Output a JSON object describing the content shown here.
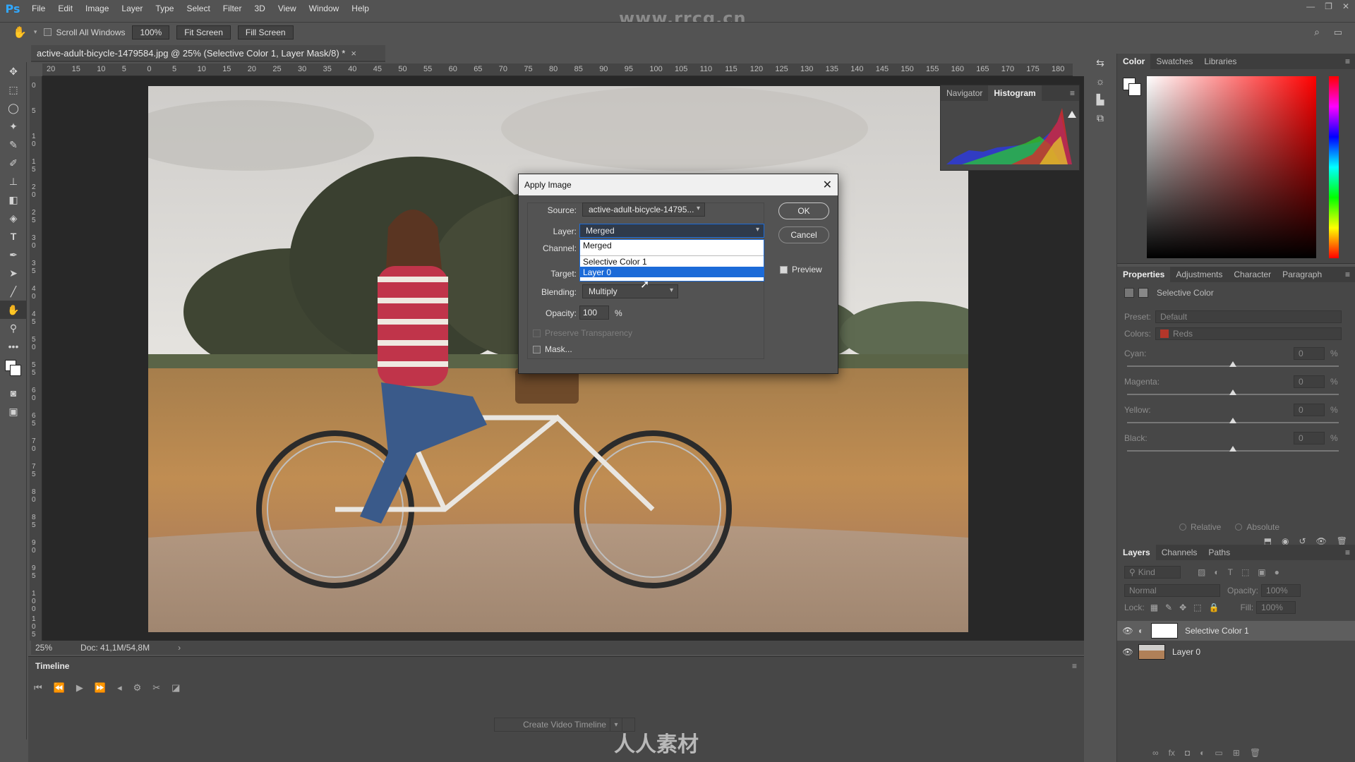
{
  "app": {
    "logo": "Ps",
    "watermark_site": "www.rrcg.cn",
    "watermark_bottom": "人人素材"
  },
  "menu": [
    "File",
    "Edit",
    "Image",
    "Layer",
    "Type",
    "Select",
    "Filter",
    "3D",
    "View",
    "Window",
    "Help"
  ],
  "options": {
    "scroll_all": "Scroll All Windows",
    "zoom": "100%",
    "fit_screen": "Fit Screen",
    "fill_screen": "Fill Screen"
  },
  "document": {
    "tab_title": "active-adult-bicycle-1479584.jpg @ 25% (Selective Color 1, Layer Mask/8) *",
    "close": "×"
  },
  "ruler_top": [
    "20",
    "15",
    "10",
    "5",
    "0",
    "5",
    "10",
    "15",
    "20",
    "25",
    "30",
    "35",
    "40",
    "45",
    "50",
    "55",
    "60",
    "65",
    "70",
    "75",
    "80",
    "85",
    "90",
    "95",
    "100",
    "105",
    "110",
    "115",
    "120",
    "125",
    "130",
    "135",
    "140",
    "145",
    "150",
    "155",
    "160",
    "165",
    "170",
    "175",
    "180"
  ],
  "ruler_left": [
    "0",
    "5",
    "1 0",
    "1 5",
    "2 0",
    "2 5",
    "3 0",
    "3 5",
    "4 0",
    "4 5",
    "5 0",
    "5 5",
    "6 0",
    "6 5",
    "7 0",
    "7 5",
    "8 0",
    "8 5",
    "9 0",
    "9 5",
    "1 0 0",
    "1 0 5"
  ],
  "status": {
    "zoom": "25%",
    "doc": "Doc: 41,1M/54,8M"
  },
  "timeline": {
    "title": "Timeline",
    "create_button": "Create Video Timeline"
  },
  "histogram_panel": {
    "tabs": [
      "Navigator",
      "Histogram"
    ],
    "active": "Histogram"
  },
  "color_panel": {
    "tabs": [
      "Color",
      "Swatches",
      "Libraries"
    ]
  },
  "properties_panel": {
    "tabs": [
      "Properties",
      "Adjustments",
      "Character",
      "Paragraph"
    ],
    "title": "Selective Color",
    "preset_label": "Preset:",
    "preset_value": "Default",
    "colors_label": "Colors:",
    "colors_value": "Reds",
    "sliders": [
      {
        "label": "Cyan:",
        "value": "0",
        "unit": "%"
      },
      {
        "label": "Magenta:",
        "value": "0",
        "unit": "%"
      },
      {
        "label": "Yellow:",
        "value": "0",
        "unit": "%"
      },
      {
        "label": "Black:",
        "value": "0",
        "unit": "%"
      }
    ],
    "relative": "Relative",
    "absolute": "Absolute"
  },
  "layers_panel": {
    "tabs": [
      "Layers",
      "Channels",
      "Paths"
    ],
    "kind": "Kind",
    "blend": "Normal",
    "opacity_label": "Opacity:",
    "opacity_value": "100%",
    "lock_label": "Lock:",
    "fill_label": "Fill:",
    "fill_value": "100%",
    "layers": [
      {
        "name": "Selective Color 1",
        "selected": true
      },
      {
        "name": "Layer 0",
        "selected": false
      }
    ]
  },
  "dialog": {
    "title": "Apply Image",
    "source_label": "Source:",
    "source_value": "active-adult-bicycle-14795...",
    "layer_label": "Layer:",
    "layer_value": "Merged",
    "channel_label": "Channel:",
    "target_label": "Target:",
    "blending_label": "Blending:",
    "blending_value": "Multiply",
    "opacity_label": "Opacity:",
    "opacity_value": "100",
    "opacity_unit": "%",
    "preserve": "Preserve Transparency",
    "mask": "Mask...",
    "ok": "OK",
    "cancel": "Cancel",
    "preview": "Preview",
    "dropdown_items": [
      "Merged",
      "",
      "Selective Color 1",
      "Layer 0"
    ],
    "dropdown_selected_index": 3
  },
  "colors": {
    "accent_blue": "#1c6bd8",
    "ps_blue": "#31a8ff"
  }
}
